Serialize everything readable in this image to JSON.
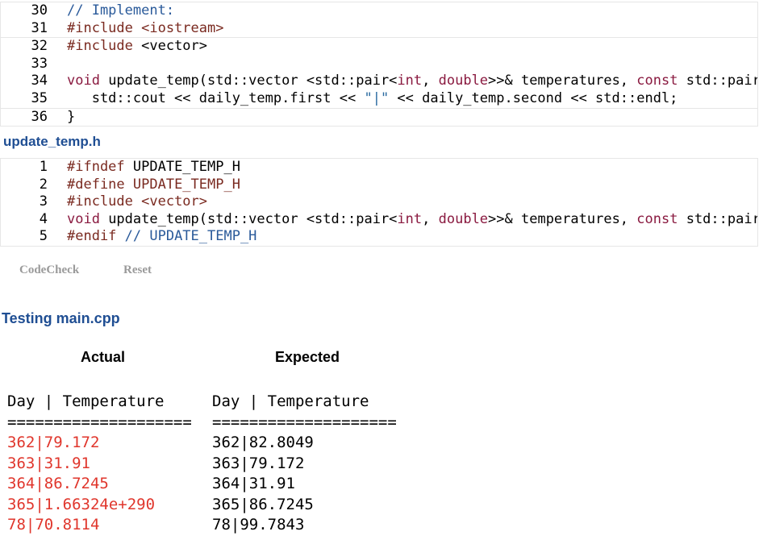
{
  "code_block_1": {
    "lines": [
      {
        "num": "30",
        "segments": [
          {
            "text": "// Implement:",
            "cls": "c-comment"
          }
        ]
      },
      {
        "num": "31",
        "segments": [
          {
            "text": "#include ",
            "cls": "c-pre"
          },
          {
            "text": "<iostream>",
            "cls": "c-pre"
          }
        ]
      },
      {
        "num": "32",
        "segments": [
          {
            "text": "#include ",
            "cls": "c-pre"
          },
          {
            "text": "<vector>",
            "cls": ""
          }
        ]
      },
      {
        "num": "33",
        "segments": []
      },
      {
        "num": "34",
        "segments": [
          {
            "text": "void",
            "cls": "c-kw"
          },
          {
            "text": " update_temp(std::vector <std::pair<",
            "cls": ""
          },
          {
            "text": "int",
            "cls": "c-kw"
          },
          {
            "text": ", ",
            "cls": ""
          },
          {
            "text": "double",
            "cls": "c-kw"
          },
          {
            "text": ">>& temperatures, ",
            "cls": ""
          },
          {
            "text": "const",
            "cls": "c-kw"
          },
          {
            "text": " std::pair<int, double>& daily_temp) {",
            "cls": ""
          }
        ]
      },
      {
        "num": "35",
        "segments": [
          {
            "text": "   std::cout << daily_temp.first << ",
            "cls": ""
          },
          {
            "text": "\"|\"",
            "cls": "c-str"
          },
          {
            "text": " << daily_temp.second << std::endl;",
            "cls": ""
          }
        ]
      },
      {
        "num": "36",
        "segments": [
          {
            "text": "}",
            "cls": ""
          }
        ]
      }
    ]
  },
  "file_title": "update_temp.h",
  "code_block_2": {
    "lines": [
      {
        "num": "1",
        "segments": [
          {
            "text": "#ifndef ",
            "cls": "c-pre"
          },
          {
            "text": "UPDATE_TEMP_H",
            "cls": ""
          }
        ]
      },
      {
        "num": "2",
        "segments": [
          {
            "text": "#define ",
            "cls": "c-pre"
          },
          {
            "text": "UPDATE_TEMP_H",
            "cls": "c-pre"
          }
        ]
      },
      {
        "num": "3",
        "segments": [
          {
            "text": "#include ",
            "cls": "c-pre"
          },
          {
            "text": "<vector>",
            "cls": "c-pre"
          }
        ]
      },
      {
        "num": "4",
        "segments": [
          {
            "text": "void",
            "cls": "c-kw"
          },
          {
            "text": " update_temp(std::vector <std::pair<",
            "cls": ""
          },
          {
            "text": "int",
            "cls": "c-kw"
          },
          {
            "text": ", ",
            "cls": ""
          },
          {
            "text": "double",
            "cls": "c-kw"
          },
          {
            "text": ">>& temperatures, ",
            "cls": ""
          },
          {
            "text": "const",
            "cls": "c-kw"
          },
          {
            "text": " std::pair<int, double>& daily_temp);",
            "cls": ""
          }
        ]
      },
      {
        "num": "5",
        "segments": [
          {
            "text": "#endif ",
            "cls": "c-pre"
          },
          {
            "text": "// UPDATE_TEMP_H",
            "cls": "c-comment"
          }
        ]
      }
    ]
  },
  "buttons": {
    "codecheck": "CodeCheck",
    "reset": "Reset"
  },
  "testing_title": "Testing main.cpp",
  "results": {
    "actual_header": "Actual",
    "expected_header": "Expected",
    "actual_lines": [
      {
        "text": "Day | Temperature",
        "mismatch": false
      },
      {
        "text": "====================",
        "mismatch": false
      },
      {
        "text": "362|79.172",
        "mismatch": true
      },
      {
        "text": "363|31.91",
        "mismatch": true
      },
      {
        "text": "364|86.7245",
        "mismatch": true
      },
      {
        "text": "365|1.66324e+290",
        "mismatch": true
      },
      {
        "text": "78|70.8114",
        "mismatch": true
      }
    ],
    "expected_lines": [
      "Day | Temperature",
      "====================",
      "362|82.8049",
      "363|79.172",
      "364|31.91",
      "365|86.7245",
      "78|99.7843"
    ]
  },
  "colors": {
    "title_blue": "#1f4e93",
    "mismatch_red": "#e0362c",
    "button_gray": "#9a9a9a"
  }
}
